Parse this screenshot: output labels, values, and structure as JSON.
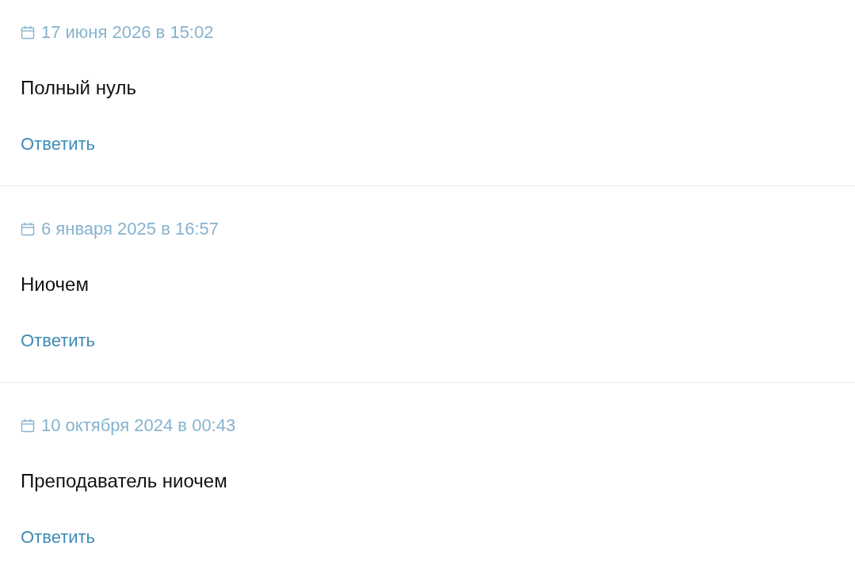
{
  "comments": [
    {
      "date": "17 июня 2026 в 15:02",
      "text": "Полный нуль",
      "reply_label": "Ответить"
    },
    {
      "date": "6 января 2025 в 16:57",
      "text": "Ниочем",
      "reply_label": "Ответить"
    },
    {
      "date": "10 октября 2024 в 00:43",
      "text": "Преподаватель ниочем",
      "reply_label": "Ответить"
    }
  ]
}
